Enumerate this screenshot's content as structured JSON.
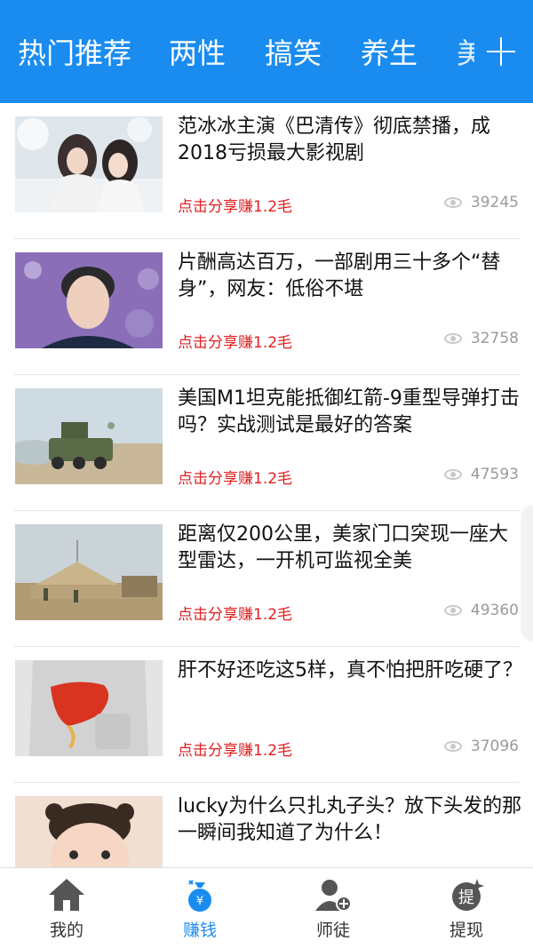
{
  "topbar": {
    "tabs": [
      {
        "label": "热门推荐",
        "active": true
      },
      {
        "label": "两性"
      },
      {
        "label": "搞笑"
      },
      {
        "label": "养生"
      },
      {
        "label": "美"
      }
    ],
    "add_icon": "plus-icon"
  },
  "feed": {
    "items": [
      {
        "title": "范冰冰主演《巴清传》彻底禁播，成2018亏损最大影视剧",
        "share": "点击分享赚1.2毛",
        "views": "39245"
      },
      {
        "title": "片酬高达百万，一部剧用三十多个“替身”，网友：低俗不堪",
        "share": "点击分享赚1.2毛",
        "views": "32758"
      },
      {
        "title": "美国M1坦克能抵御红箭-9重型导弹打击吗？实战测试是最好的答案",
        "share": "点击分享赚1.2毛",
        "views": "47593"
      },
      {
        "title": "距离仅200公里，美家门口突现一座大型雷达，一开机可监视全美",
        "share": "点击分享赚1.2毛",
        "views": "49360"
      },
      {
        "title": "肝不好还吃这5样，真不怕把肝吃硬了？",
        "share": "点击分享赚1.2毛",
        "views": "37096"
      },
      {
        "title": "lucky为什么只扎丸子头？放下头发的那一瞬间我知道了为什么！",
        "share": "",
        "views": ""
      }
    ]
  },
  "bottom_nav": [
    {
      "label": "我的",
      "icon": "home-icon"
    },
    {
      "label": "赚钱",
      "icon": "money-bag-icon",
      "active": true
    },
    {
      "label": "师徒",
      "icon": "add-user-icon"
    },
    {
      "label": "提现",
      "icon": "withdraw-icon",
      "glyph": "提"
    }
  ],
  "colors": {
    "accent": "#1a8cf0",
    "share": "#e02020",
    "views": "#9a9a9a"
  }
}
